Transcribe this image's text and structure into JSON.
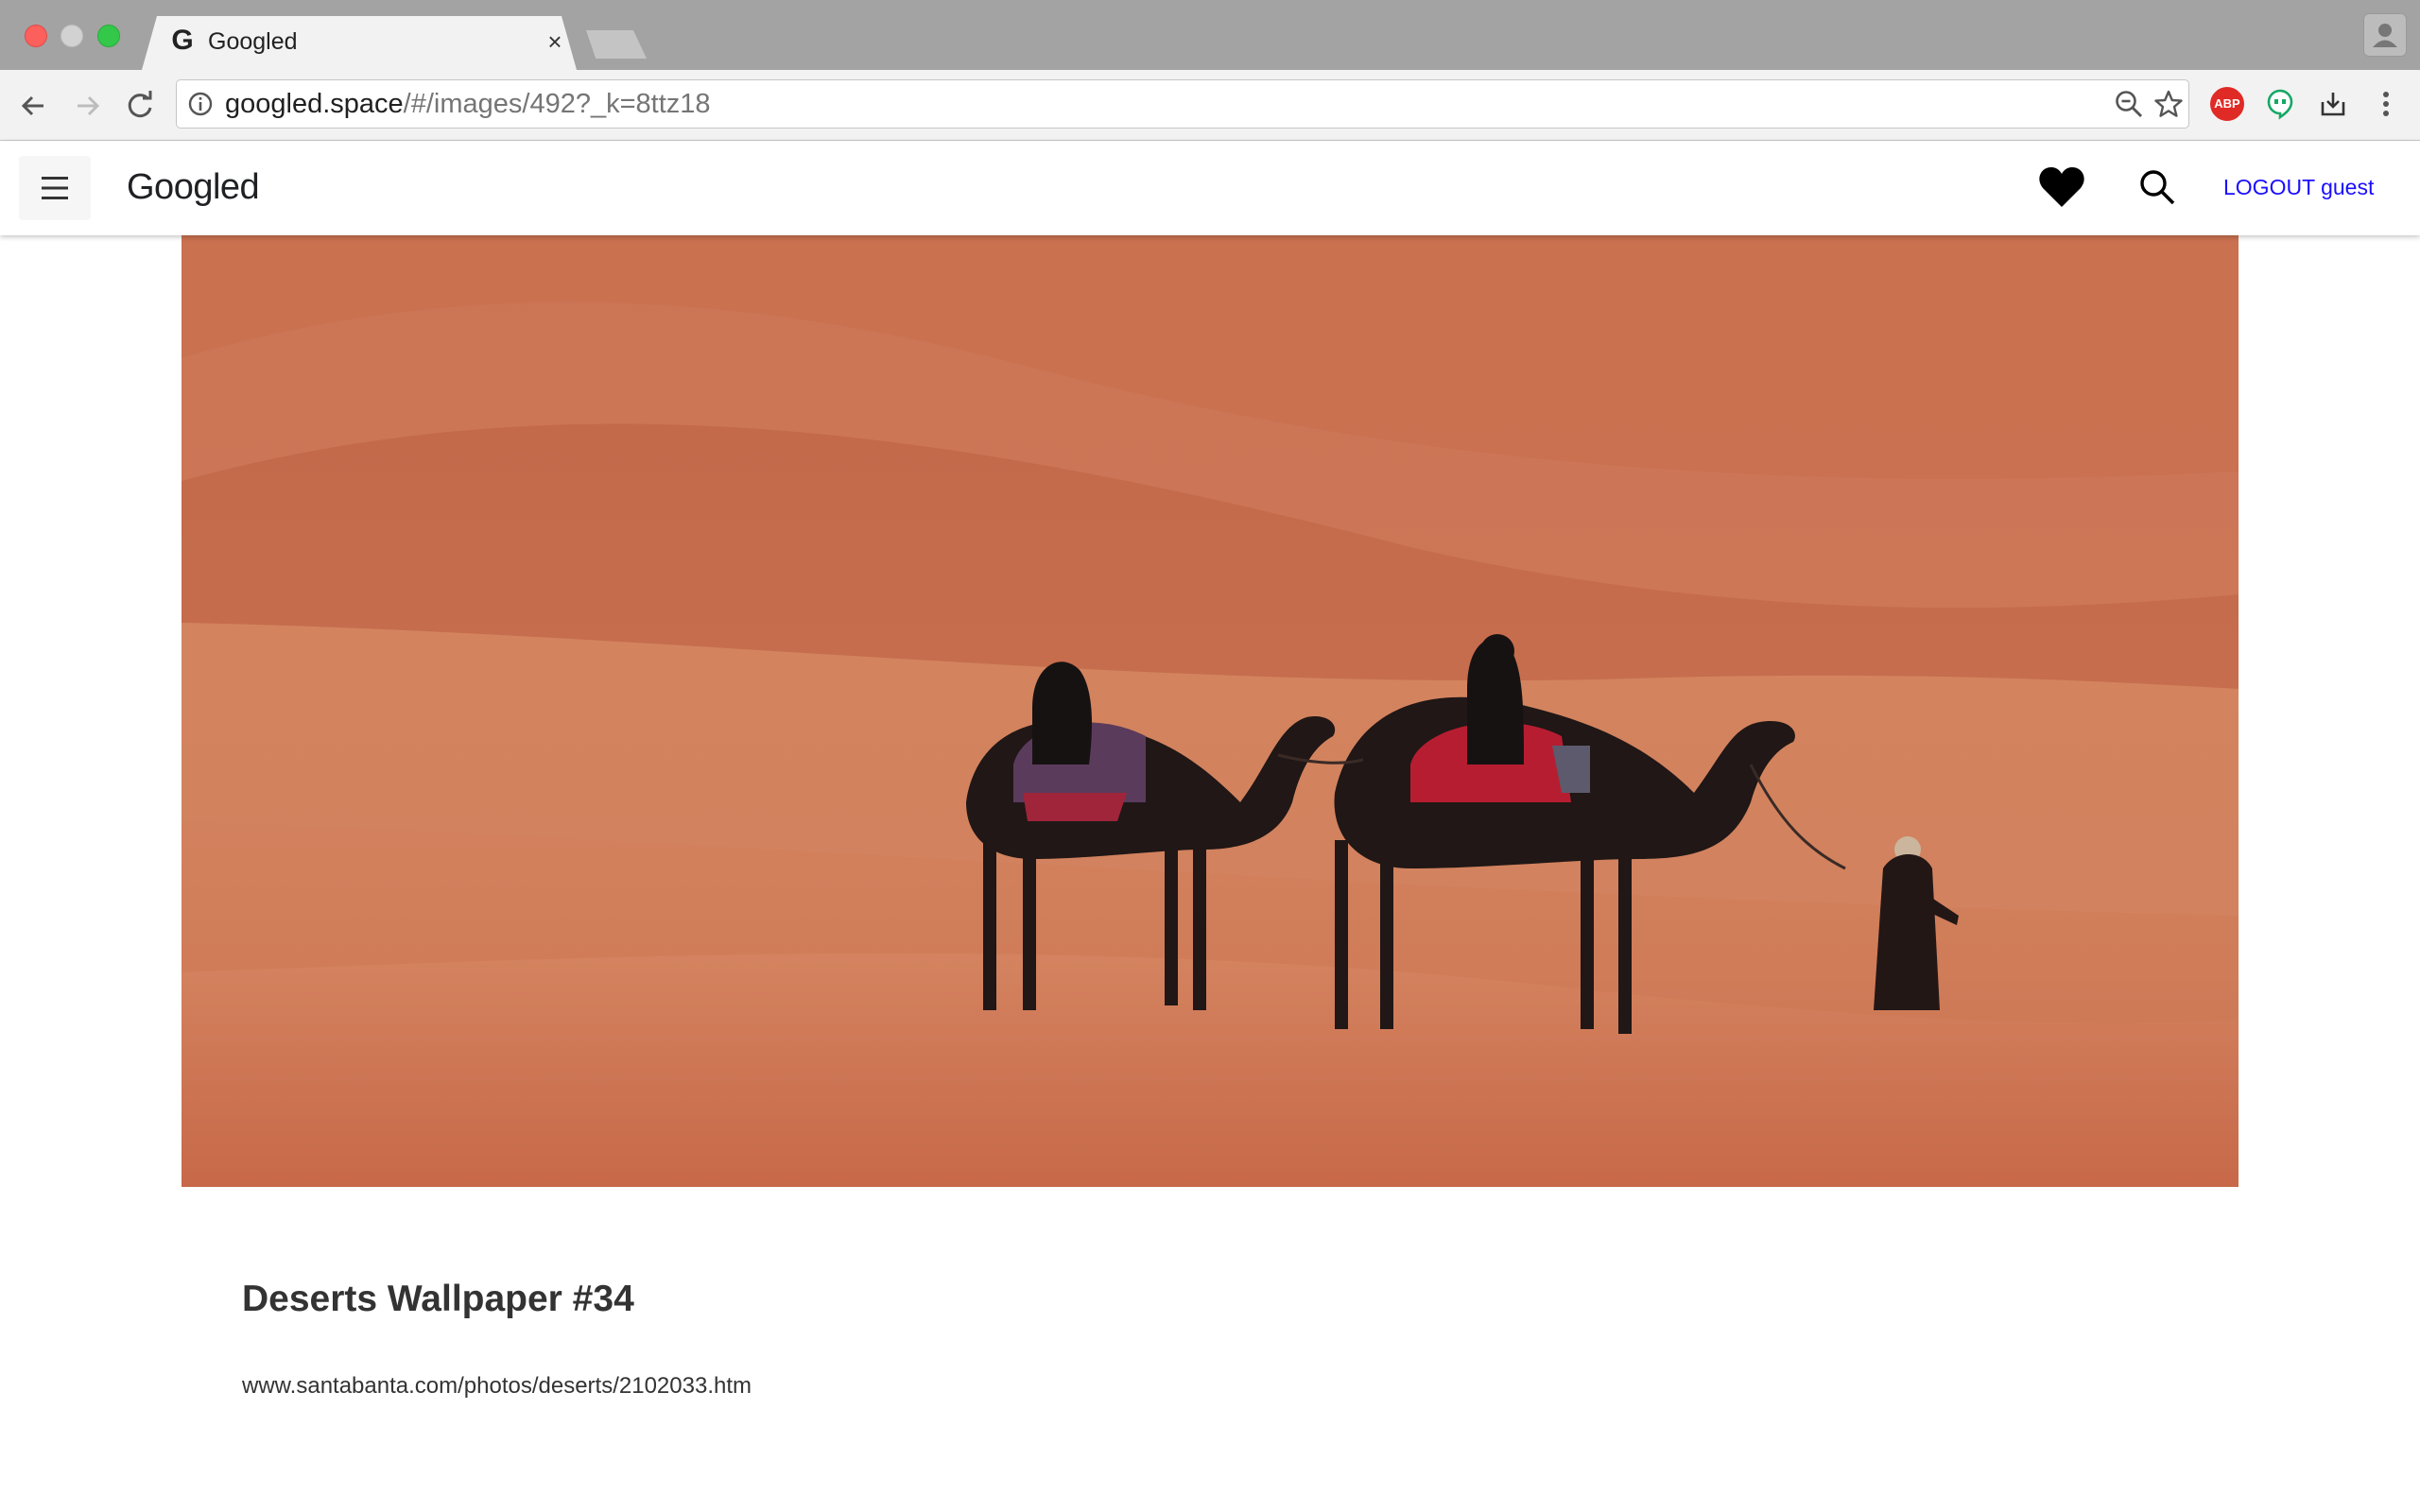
{
  "browser": {
    "tab_title": "Googled",
    "tab_favicon": "G",
    "tab_close": "×",
    "url_host": "googled.space",
    "url_path": "/#/images/492?_k=8ttz18",
    "extension_abp": "ABP"
  },
  "app": {
    "brand": "Googled",
    "logout_label": "LOGOUT guest"
  },
  "image": {
    "title": "Deserts Wallpaper #34",
    "source": "www.santabanta.com/photos/deserts/2102033.htm",
    "description": "camel caravan crossing orange sand dunes"
  },
  "icons": [
    "back-arrow-icon",
    "forward-arrow-icon",
    "reload-icon",
    "info-icon",
    "zoom-out-icon",
    "star-icon",
    "abp-icon",
    "hangouts-icon",
    "download-icon",
    "kebab-menu-icon",
    "hamburger-icon",
    "heart-icon",
    "search-icon",
    "profile-icon"
  ]
}
